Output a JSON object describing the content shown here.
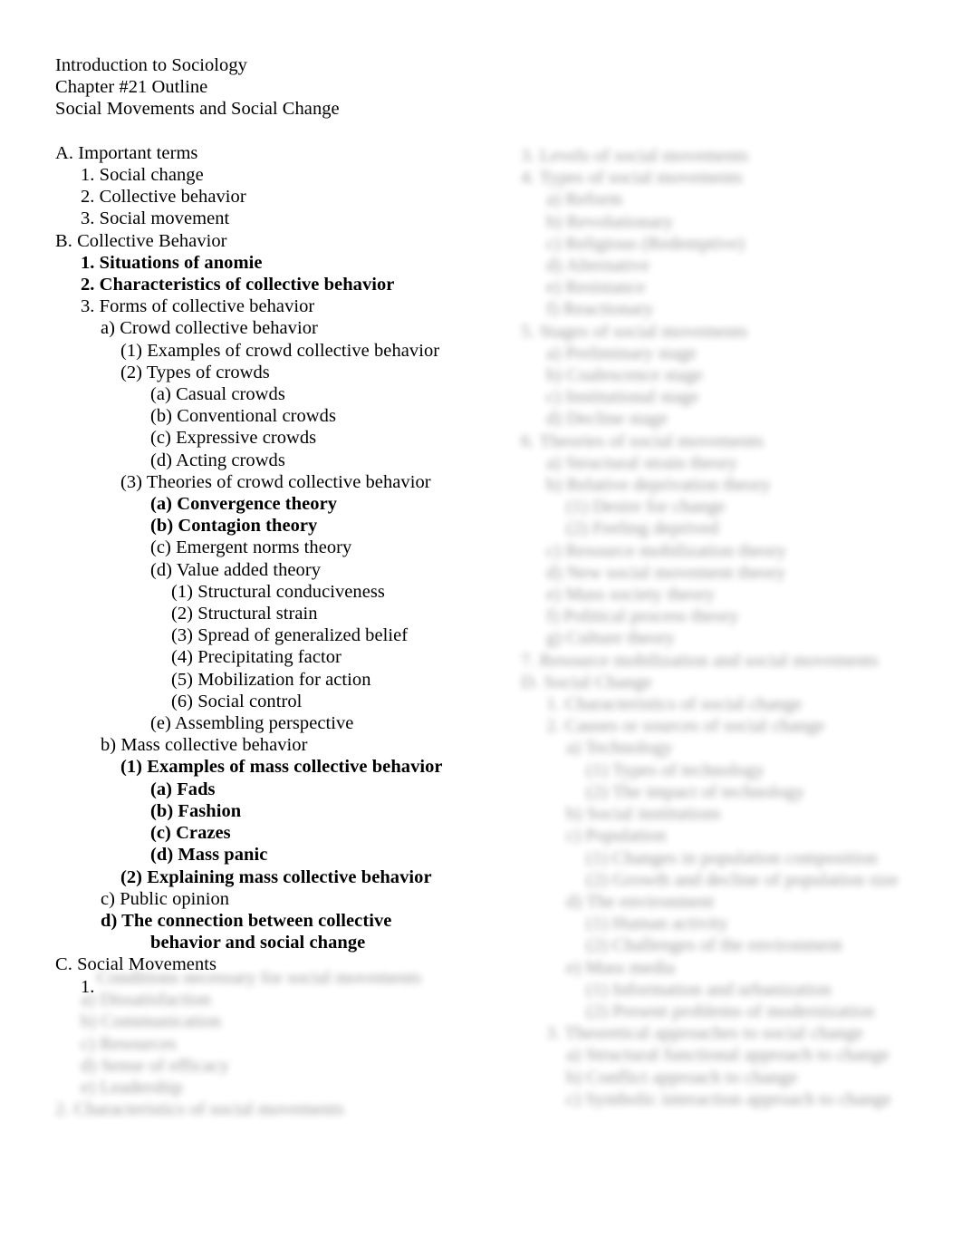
{
  "document": {
    "course": "Introduction to Sociology",
    "chapter": "Chapter #21 Outline",
    "subject": "Social Movements and Social Change"
  },
  "outline": {
    "lines": [
      {
        "text": "A. Important terms",
        "indent": 0,
        "bold": false
      },
      {
        "text": "1. Social change",
        "indent": 1,
        "bold": false
      },
      {
        "text": "2. Collective behavior",
        "indent": 1,
        "bold": false
      },
      {
        "text": "3. Social movement",
        "indent": 1,
        "bold": false
      },
      {
        "text": "B. Collective Behavior",
        "indent": 0,
        "bold": false
      },
      {
        "text": "1. Situations of anomie",
        "indent": 1,
        "bold": true
      },
      {
        "text": "2. Characteristics of collective behavior",
        "indent": 1,
        "bold": true
      },
      {
        "text": "3. Forms of collective behavior",
        "indent": 1,
        "bold": false
      },
      {
        "text": "a) Crowd collective behavior",
        "indent": 2,
        "bold": false
      },
      {
        "text": "(1) Examples of crowd collective behavior",
        "indent": 3,
        "bold": false
      },
      {
        "text": "(2) Types of crowds",
        "indent": 3,
        "bold": false
      },
      {
        "text": "(a) Casual crowds",
        "indent": 4,
        "bold": false
      },
      {
        "text": "(b) Conventional crowds",
        "indent": 4,
        "bold": false
      },
      {
        "text": "(c) Expressive crowds",
        "indent": 4,
        "bold": false
      },
      {
        "text": "(d) Acting crowds",
        "indent": 4,
        "bold": false
      },
      {
        "text": "(3) Theories of crowd collective behavior",
        "indent": 3,
        "bold": false
      },
      {
        "text": "(a) Convergence theory",
        "indent": 4,
        "bold": true
      },
      {
        "text": "(b) Contagion theory",
        "indent": 4,
        "bold": true
      },
      {
        "text": "(c) Emergent norms theory",
        "indent": 4,
        "bold": false
      },
      {
        "text": "(d) Value added theory",
        "indent": 4,
        "bold": false
      },
      {
        "text": "(1) Structural conduciveness",
        "indent": 5,
        "bold": false
      },
      {
        "text": "(2) Structural strain",
        "indent": 5,
        "bold": false
      },
      {
        "text": "(3) Spread of generalized belief",
        "indent": 5,
        "bold": false
      },
      {
        "text": "(4) Precipitating factor",
        "indent": 5,
        "bold": false
      },
      {
        "text": "(5) Mobilization for action",
        "indent": 5,
        "bold": false
      },
      {
        "text": "(6) Social control",
        "indent": 5,
        "bold": false
      },
      {
        "text": "(e) Assembling perspective",
        "indent": 4,
        "bold": false
      },
      {
        "text": "b) Mass collective behavior",
        "indent": 2,
        "bold": false
      },
      {
        "text": "(1) Examples of mass collective behavior",
        "indent": 3,
        "bold": true
      },
      {
        "text": "(a) Fads",
        "indent": 4,
        "bold": true
      },
      {
        "text": "(b) Fashion",
        "indent": 4,
        "bold": true
      },
      {
        "text": "(c) Crazes",
        "indent": 4,
        "bold": true
      },
      {
        "text": "(d) Mass panic",
        "indent": 4,
        "bold": true
      },
      {
        "text": "(2) Explaining mass collective behavior",
        "indent": 3,
        "bold": true
      },
      {
        "text": "c) Public opinion",
        "indent": 2,
        "bold": false
      },
      {
        "text": "d) The connection between collective",
        "indent": 2,
        "bold": true
      },
      {
        "text": "behavior and social change",
        "indent": 3,
        "bold": true
      },
      {
        "text": "C. Social Movements",
        "indent": 0,
        "bold": false
      },
      {
        "text": "1.",
        "indent": 1,
        "bold": false
      }
    ]
  },
  "redacted_bottom_left": {
    "note": "blurred-illegible",
    "lines": [
      {
        "text": "Conditions necessary for social movements",
        "indent": 0,
        "bold": false
      },
      {
        "text": "a) Dissatisfaction",
        "indent": 1,
        "bold": false
      },
      {
        "text": "b) Communication",
        "indent": 1,
        "bold": false
      },
      {
        "text": "c) Resources",
        "indent": 1,
        "bold": false
      },
      {
        "text": "d) Sense of efficacy",
        "indent": 1,
        "bold": false
      },
      {
        "text": "e) Leadership",
        "indent": 1,
        "bold": false
      },
      {
        "text": "2. Characteristics of social movements",
        "indent": 0,
        "bold": false
      }
    ]
  },
  "redacted_right_column": {
    "note": "blurred-illegible",
    "lines": [
      {
        "text": "3. Levels of social movements",
        "indent": 0,
        "bold": false
      },
      {
        "text": "4. Types of social movements",
        "indent": 0,
        "bold": false
      },
      {
        "text": "a) Reform",
        "indent": 1,
        "bold": false
      },
      {
        "text": "b) Revolutionary",
        "indent": 1,
        "bold": false
      },
      {
        "text": "c) Religious (Redemptive)",
        "indent": 1,
        "bold": false
      },
      {
        "text": "d) Alternative",
        "indent": 1,
        "bold": false
      },
      {
        "text": "e) Resistance",
        "indent": 1,
        "bold": false
      },
      {
        "text": "f) Reactionary",
        "indent": 1,
        "bold": false
      },
      {
        "text": "5. Stages of social movements",
        "indent": 0,
        "bold": false
      },
      {
        "text": "a) Preliminary stage",
        "indent": 1,
        "bold": false
      },
      {
        "text": "b) Coalescence stage",
        "indent": 1,
        "bold": false
      },
      {
        "text": "c) Institutional stage",
        "indent": 1,
        "bold": false
      },
      {
        "text": "d) Decline stage",
        "indent": 1,
        "bold": false
      },
      {
        "text": "6. Theories of social movements",
        "indent": 0,
        "bold": false
      },
      {
        "text": "a) Structural strain theory",
        "indent": 1,
        "bold": false
      },
      {
        "text": "b) Relative deprivation theory",
        "indent": 1,
        "bold": false
      },
      {
        "text": "(1) Desire for change",
        "indent": 2,
        "bold": false
      },
      {
        "text": "(2) Feeling deprived",
        "indent": 2,
        "bold": false
      },
      {
        "text": "c) Resource mobilization theory",
        "indent": 1,
        "bold": false
      },
      {
        "text": "d) New social movement theory",
        "indent": 1,
        "bold": false
      },
      {
        "text": "e) Mass society theory",
        "indent": 1,
        "bold": false
      },
      {
        "text": "f) Political process theory",
        "indent": 1,
        "bold": false
      },
      {
        "text": "g) Culture theory",
        "indent": 1,
        "bold": false
      },
      {
        "text": "7. Resource mobilization and social movements",
        "indent": 0,
        "bold": false
      },
      {
        "text": "D. Social Change",
        "indent": 0,
        "bold": false
      },
      {
        "text": "1. Characteristics of social change",
        "indent": 1,
        "bold": false
      },
      {
        "text": "2. Causes or sources of social change",
        "indent": 1,
        "bold": false
      },
      {
        "text": "a) Technology",
        "indent": 2,
        "bold": false
      },
      {
        "text": "(1) Types of technology",
        "indent": 3,
        "bold": false
      },
      {
        "text": "(2) The impact of technology",
        "indent": 3,
        "bold": false
      },
      {
        "text": "b) Social institutions",
        "indent": 2,
        "bold": false
      },
      {
        "text": "c) Population",
        "indent": 2,
        "bold": false
      },
      {
        "text": "(1) Changes in population composition",
        "indent": 3,
        "bold": false
      },
      {
        "text": "(2) Growth and decline of population size",
        "indent": 3,
        "bold": false
      },
      {
        "text": "d) The environment",
        "indent": 2,
        "bold": false
      },
      {
        "text": "(1) Human activity",
        "indent": 3,
        "bold": false
      },
      {
        "text": "(2) Challenges of the environment",
        "indent": 3,
        "bold": false
      },
      {
        "text": "e) Mass media",
        "indent": 2,
        "bold": false
      },
      {
        "text": "(1) Information and urbanization",
        "indent": 3,
        "bold": false
      },
      {
        "text": "(2) Present problems of modernization",
        "indent": 3,
        "bold": false
      },
      {
        "text": "3. Theoretical approaches to social change",
        "indent": 1,
        "bold": false
      },
      {
        "text": "a) Structural functional approach to change",
        "indent": 2,
        "bold": false
      },
      {
        "text": "b) Conflict approach to change",
        "indent": 2,
        "bold": false
      },
      {
        "text": "c) Symbolic interaction approach to change",
        "indent": 2,
        "bold": false
      }
    ]
  }
}
